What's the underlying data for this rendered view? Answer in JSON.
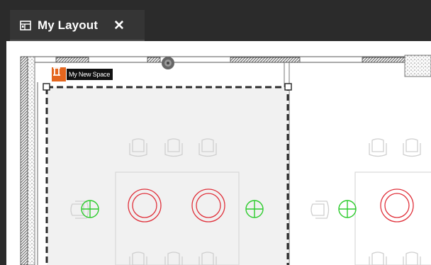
{
  "tab": {
    "title": "My Layout",
    "close_glyph": "✕",
    "icon": "layout-icon"
  },
  "space": {
    "label": "My New Space",
    "icon": "space-icon",
    "color": "#e4661e"
  },
  "colors": {
    "wall": "#555555",
    "selection": "#333333",
    "furniture": "#cfcfcf",
    "fixture_red": "#e0303a",
    "fixture_green": "#2ecc2e"
  }
}
